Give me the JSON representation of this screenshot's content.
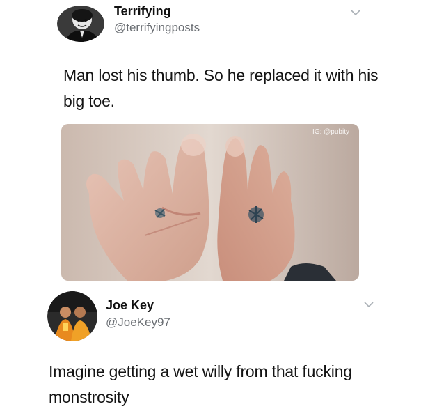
{
  "tweets": [
    {
      "display_name": "Terrifying",
      "handle": "@terrifyingposts",
      "text": "Man lost his thumb. So he replaced it with his big toe.",
      "media_watermark": "IG: @pubity",
      "avatar_icon": "dark-portrait-avatar",
      "menu_icon": "chevron-down-icon"
    },
    {
      "display_name": "Joe Key",
      "handle": "@JoeKey97",
      "text": "Imagine getting a wet willy from that fucking monstrosity",
      "avatar_icon": "orange-photo-avatar",
      "menu_icon": "chevron-down-icon"
    }
  ],
  "colors": {
    "background": "#ffffff",
    "handle_gray": "#6b6f74",
    "chevron_gray": "#aab0b6",
    "text": "#141414"
  }
}
